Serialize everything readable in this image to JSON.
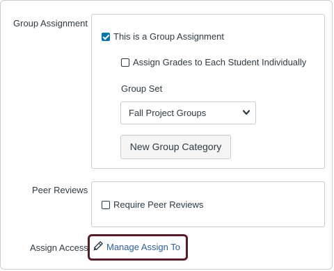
{
  "group_assignment": {
    "label": "Group Assignment",
    "is_group_label": "This is a Group Assignment",
    "is_group_checked": true,
    "grade_individually_label": "Assign Grades to Each Student Individually",
    "grade_individually_checked": false,
    "group_set_label": "Group Set",
    "group_set_value": "Fall Project Groups",
    "new_category_button": "New Group Category"
  },
  "peer_reviews": {
    "label": "Peer Reviews",
    "require_label": "Require Peer Reviews",
    "require_checked": false
  },
  "assign_access": {
    "label": "Assign Access",
    "link_text": "Manage Assign To",
    "icon": "pencil-icon"
  },
  "colors": {
    "accent": "#0374b5",
    "link": "#2b5ea7",
    "highlight_border": "#5a1b25"
  }
}
